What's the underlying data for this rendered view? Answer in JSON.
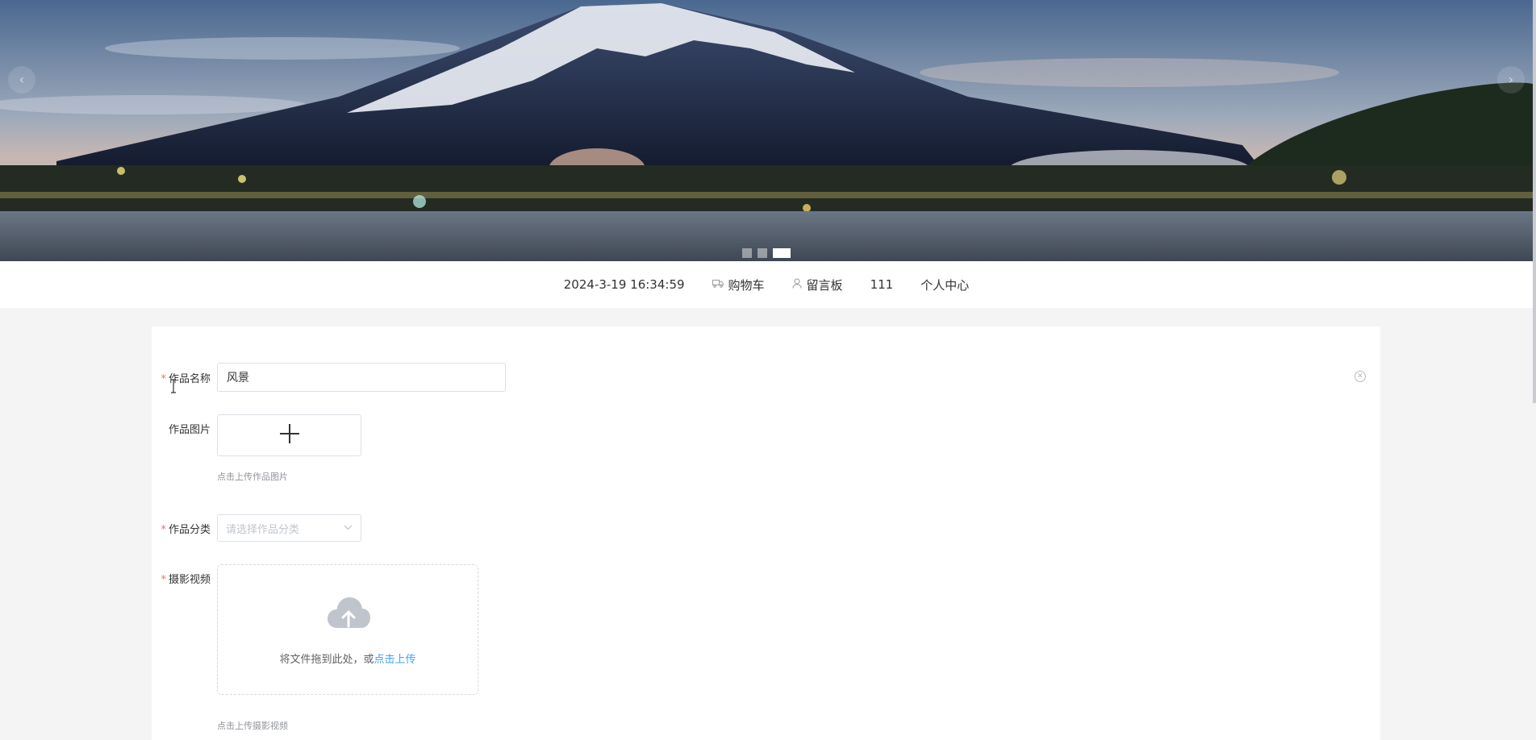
{
  "nav": {
    "datetime": "2024-3-19 16:34:59",
    "cart_label": "购物车",
    "message_board_label": "留言板",
    "count_label": "111",
    "profile_label": "个人中心"
  },
  "carousel": {
    "prev_glyph": "‹",
    "next_glyph": "›",
    "slide_count": 3,
    "active_index": 2
  },
  "form": {
    "name": {
      "required_mark": "*",
      "label": "作品名称",
      "value": "风景"
    },
    "image": {
      "label": "作品图片",
      "tip": "点击上传作品图片"
    },
    "category": {
      "required_mark": "*",
      "label": "作品分类",
      "placeholder": "请选择作品分类"
    },
    "video": {
      "required_mark": "*",
      "label": "摄影视频",
      "drop_text": "将文件拖到此处，或",
      "drop_link": "点击上传",
      "tip": "点击上传摄影视频"
    }
  },
  "icons": {
    "cart": "truck-icon",
    "message_board": "user-icon",
    "close": "close-circle-icon",
    "upload_plus": "plus-icon",
    "dropdown": "chevron-down-icon",
    "cloud": "cloud-upload-icon"
  },
  "colors": {
    "required": "#f56c6c",
    "link": "#409eff",
    "page_bg": "#f4f4f4"
  }
}
